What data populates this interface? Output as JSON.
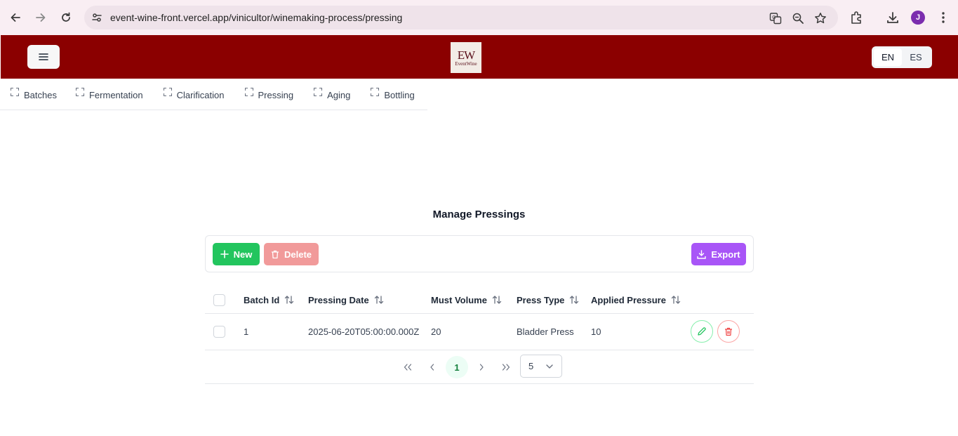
{
  "browser": {
    "url": "event-wine-front.vercel.app/vinicultor/winemaking-process/pressing",
    "profile_initial": "J"
  },
  "header": {
    "logo_mark": "EW",
    "logo_word": "EventWine",
    "languages": [
      {
        "label": "EN",
        "active": true
      },
      {
        "label": "ES",
        "active": false
      }
    ],
    "brand_color": "#8b0000"
  },
  "tabs": [
    {
      "label": "Batches"
    },
    {
      "label": "Fermentation"
    },
    {
      "label": "Clarification"
    },
    {
      "label": "Pressing"
    },
    {
      "label": "Aging"
    },
    {
      "label": "Bottling"
    }
  ],
  "main": {
    "title": "Manage Pressings",
    "toolbar": {
      "new_label": "New",
      "delete_label": "Delete",
      "export_label": "Export"
    },
    "table": {
      "columns": [
        "Batch Id",
        "Pressing Date",
        "Must Volume",
        "Press Type",
        "Applied Pressure"
      ],
      "rows": [
        {
          "batch_id": "1",
          "pressing_date": "2025-06-20T05:00:00.000Z",
          "must_volume": "20",
          "press_type": "Bladder Press",
          "applied_pressure": "10"
        }
      ]
    },
    "paginator": {
      "current_page": "1",
      "rows_per_page": "5"
    }
  },
  "colors": {
    "new": "#22c55e",
    "delete": "#f19a9a",
    "export": "#a855f7"
  }
}
